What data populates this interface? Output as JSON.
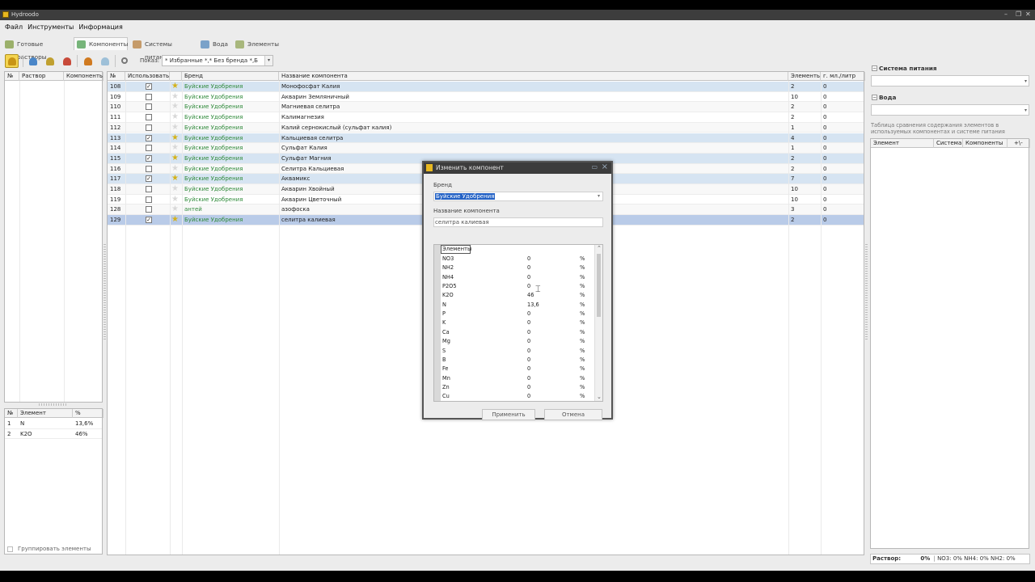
{
  "window": {
    "title": "Hydroodo"
  },
  "menu": [
    "Файл",
    "Инструменты",
    "Информация"
  ],
  "nav_tabs": [
    {
      "label": "Готовые растворы",
      "active": false
    },
    {
      "label": "Компоненты",
      "active": true
    },
    {
      "label": "Системы питания",
      "active": false
    },
    {
      "label": "Вода",
      "active": false
    },
    {
      "label": "Элементы",
      "active": false
    }
  ],
  "toolbar": {
    "icons": [
      "star-folder-icon",
      "flask-add-icon",
      "flask-edit-icon",
      "flask-delete-icon",
      "flask-copy-icon",
      "flask-icon",
      "search-icon"
    ],
    "show_label": "Показ:",
    "show_value": "* Избранные *,* Без бренда *,Б"
  },
  "left_table": {
    "headers": [
      "№",
      "Раствор",
      "Компоненты"
    ]
  },
  "left_bottom": {
    "headers": [
      "№",
      "Элемент",
      "%"
    ],
    "rows": [
      {
        "n": "1",
        "el": "N",
        "pct": "13,6%"
      },
      {
        "n": "2",
        "el": "K2O",
        "pct": "46%"
      }
    ],
    "group_label": "Группировать элементы"
  },
  "main_table": {
    "headers": [
      "№",
      "Использовать",
      "",
      "Бренд",
      "Название компонента",
      "Элементы",
      "г. мл./литр"
    ],
    "rows": [
      {
        "n": "108",
        "use": true,
        "fav": true,
        "brand": "Буйские Удобрения",
        "name": "Монофосфат Калия",
        "el": "2",
        "g": "0",
        "state": "hl"
      },
      {
        "n": "109",
        "use": false,
        "fav": false,
        "brand": "Буйские Удобрения",
        "name": "Акварин Земляничный",
        "el": "10",
        "g": "0",
        "state": ""
      },
      {
        "n": "110",
        "use": false,
        "fav": false,
        "brand": "Буйские Удобрения",
        "name": "Магниевая селитра",
        "el": "2",
        "g": "0",
        "state": "alt"
      },
      {
        "n": "111",
        "use": false,
        "fav": false,
        "brand": "Буйские Удобрения",
        "name": "Калимагнезия",
        "el": "2",
        "g": "0",
        "state": ""
      },
      {
        "n": "112",
        "use": false,
        "fav": false,
        "brand": "Буйские Удобрения",
        "name": "Калий сернокислый (сульфат калия)",
        "el": "1",
        "g": "0",
        "state": "alt"
      },
      {
        "n": "113",
        "use": true,
        "fav": true,
        "brand": "Буйские Удобрения",
        "name": "Кальциевая селитра",
        "el": "4",
        "g": "0",
        "state": "hl"
      },
      {
        "n": "114",
        "use": false,
        "fav": false,
        "brand": "Буйские Удобрения",
        "name": "Сульфат Калия",
        "el": "1",
        "g": "0",
        "state": "alt"
      },
      {
        "n": "115",
        "use": true,
        "fav": true,
        "brand": "Буйские Удобрения",
        "name": "Сульфат Магния",
        "el": "2",
        "g": "0",
        "state": "hl"
      },
      {
        "n": "116",
        "use": false,
        "fav": false,
        "brand": "Буйские Удобрения",
        "name": "Селитра Кальциевая",
        "el": "2",
        "g": "0",
        "state": "alt"
      },
      {
        "n": "117",
        "use": true,
        "fav": true,
        "brand": "Буйские Удобрения",
        "name": "Аквамикс",
        "el": "7",
        "g": "0",
        "state": "hl"
      },
      {
        "n": "118",
        "use": false,
        "fav": false,
        "brand": "Буйские Удобрения",
        "name": "Акварин Хвойный",
        "el": "10",
        "g": "0",
        "state": "alt"
      },
      {
        "n": "119",
        "use": false,
        "fav": false,
        "brand": "Буйские Удобрения",
        "name": "Акварин Цветочный",
        "el": "10",
        "g": "0",
        "state": ""
      },
      {
        "n": "128",
        "use": false,
        "fav": false,
        "brand": "антей",
        "name": "азофоска",
        "el": "3",
        "g": "0",
        "state": "alt"
      },
      {
        "n": "129",
        "use": true,
        "fav": true,
        "brand": "Буйские Удобрения",
        "name": "селитра калиевая",
        "el": "2",
        "g": "0",
        "state": "sel"
      }
    ]
  },
  "dialog": {
    "title": "Изменить компонент",
    "brand_label": "Бренд",
    "brand_value": "Буйские Удобрения",
    "name_label": "Название компонента",
    "name_value": "селитра калиевая",
    "elements_header": "Элементы",
    "elements": [
      {
        "el": "NO3",
        "v": "0",
        "u": "%"
      },
      {
        "el": "NH2",
        "v": "0",
        "u": "%"
      },
      {
        "el": "NH4",
        "v": "0",
        "u": "%"
      },
      {
        "el": "P2O5",
        "v": "0",
        "u": "%"
      },
      {
        "el": "K2O",
        "v": "46",
        "u": "%"
      },
      {
        "el": "N",
        "v": "13,6",
        "u": "%"
      },
      {
        "el": "P",
        "v": "0",
        "u": "%"
      },
      {
        "el": "K",
        "v": "0",
        "u": "%"
      },
      {
        "el": "Ca",
        "v": "0",
        "u": "%"
      },
      {
        "el": "Mg",
        "v": "0",
        "u": "%"
      },
      {
        "el": "S",
        "v": "0",
        "u": "%"
      },
      {
        "el": "B",
        "v": "0",
        "u": "%"
      },
      {
        "el": "Fe",
        "v": "0",
        "u": "%"
      },
      {
        "el": "Mn",
        "v": "0",
        "u": "%"
      },
      {
        "el": "Zn",
        "v": "0",
        "u": "%"
      },
      {
        "el": "Cu",
        "v": "0",
        "u": "%"
      }
    ],
    "apply_label": "Применить",
    "cancel_label": "Отмена"
  },
  "side": {
    "system_label": "Система питания",
    "water_label": "Вода",
    "note": "Таблица сравнения содержания элементов в используемых компонентах и системе питания",
    "headers": [
      "Элемент",
      "Система",
      "Компоненты",
      "+\\-"
    ],
    "status_label": "Раствор:",
    "status_pct": "0%",
    "status_detail": "NO3: 0% NH4: 0% NH2: 0%"
  },
  "colors": {
    "brand_green": "#2f8a3a",
    "selection": "#b9cbe8",
    "highlight": "#d6e4f2",
    "title_bar": "#3d3d3d"
  }
}
